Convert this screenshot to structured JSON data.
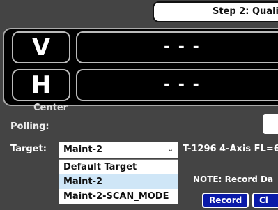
{
  "header": {
    "step_title": "Step 2: Quali"
  },
  "readouts": {
    "v": {
      "label": "V",
      "value": "- - -"
    },
    "h": {
      "label": "H",
      "value": "- - -"
    }
  },
  "labels": {
    "center": "Center",
    "polling": "Polling:",
    "target": "Target:"
  },
  "target": {
    "selected": "Maint-2",
    "chevron": "⌄",
    "info": "T-1296 4-Axis FL=6",
    "options": [
      {
        "label": "Default Target",
        "selected": false
      },
      {
        "label": "Maint-2",
        "selected": true
      },
      {
        "label": "Maint-2-SCAN_MODE",
        "selected": false
      }
    ]
  },
  "note": "NOTE: Record Da",
  "buttons": {
    "record": "Record",
    "clear": "Cl"
  },
  "colors": {
    "background": "#444444",
    "panel": "#000000",
    "button": "#0a1aa8",
    "selected_option": "#cfe6f7"
  }
}
